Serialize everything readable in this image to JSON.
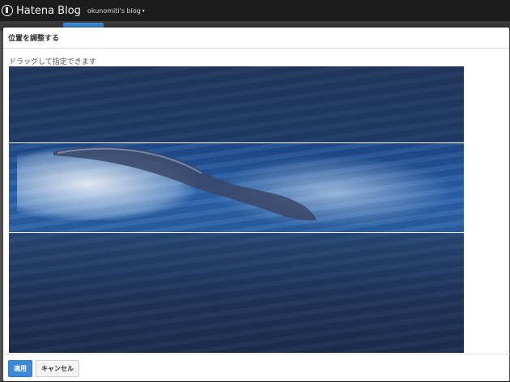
{
  "app": {
    "logo_text": "Hatena Blog",
    "blog_name": "okunomiti's blog",
    "blog_caret": "▾"
  },
  "modal": {
    "title": "位置を調整する",
    "hint": "ドラッグして指定できます",
    "apply_label": "適用",
    "cancel_label": "キャンセル"
  },
  "colors": {
    "accent": "#3b8ad9",
    "topbar": "#1c1c1c"
  }
}
